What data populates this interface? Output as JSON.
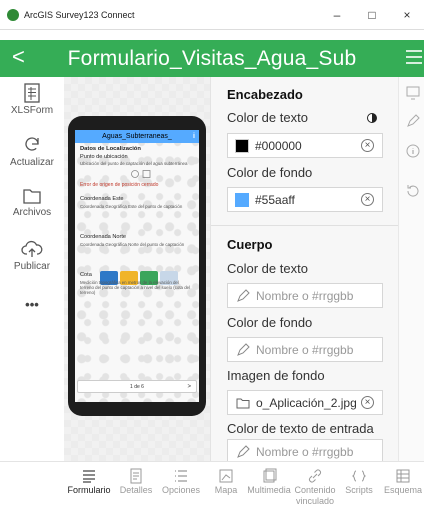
{
  "window": {
    "title": "ArcGIS Survey123 Connect",
    "minimize": "–",
    "maximize": "□",
    "close": "×"
  },
  "appbar": {
    "back_icon": "chevron-left-icon",
    "back": "<",
    "title": "Formulario_Visitas_Agua_Sub",
    "menu_icon": "hamburger-icon",
    "accent": "#35ad56"
  },
  "rail": {
    "items": [
      {
        "label": "XLSForm",
        "icon": "spreadsheet-icon"
      },
      {
        "label": "Actualizar",
        "icon": "refresh-icon"
      },
      {
        "label": "Archivos",
        "icon": "folder-icon"
      },
      {
        "label": "Publicar",
        "icon": "cloud-upload-icon"
      },
      {
        "label": "•••",
        "icon": "more-icon"
      }
    ]
  },
  "preview": {
    "header_title": "Aguas_Subterraneas_",
    "header_info": "i",
    "section": "Datos de Localización",
    "point_label": "Punto de ubicación",
    "point_hint": "Ubicación del punto de captación del agua subterránea",
    "position_error": "Error de origen de posición cerrado",
    "east_label": "Coordenada Este",
    "east_hint": "Coordenada Geográfica Este del punto de captación",
    "north_label": "Coordenada Norte",
    "north_hint": "Coordenada Geográfica Norte del punto de captación",
    "elevation_label": "Cota",
    "elevation_hint": "Medición topográfica en metros de la elevación del terreno del punto de captación a nivel del suelo (cota del terreno)",
    "page_indicator": "1 de 6",
    "next": ">",
    "header_color": "#55aaff"
  },
  "panel": {
    "header_section": "Encabezado",
    "header_text_color_label": "Color de texto",
    "header_text_color_value": "#000000",
    "header_bg_color_label": "Color de fondo",
    "header_bg_color_value": "#55aaff",
    "body_section": "Cuerpo",
    "body_text_color_label": "Color de texto",
    "body_bg_color_label": "Color de fondo",
    "body_bg_image_label": "Imagen de fondo",
    "body_bg_image_value": "o_Aplicación_2.jpg",
    "input_text_color_label": "Color de texto de entrada",
    "placeholder": "Nombre o #rrggbb",
    "clear": "×"
  },
  "strip": {
    "icons": [
      "monitor-icon",
      "brush-icon",
      "info-icon",
      "reset-icon"
    ]
  },
  "tabs": [
    {
      "label": "Formulario",
      "icon": "form-icon",
      "active": true
    },
    {
      "label": "Detalles",
      "icon": "details-icon",
      "active": false
    },
    {
      "label": "Opciones",
      "icon": "list-icon",
      "active": false
    },
    {
      "label": "Mapa",
      "icon": "map-icon",
      "active": false
    },
    {
      "label": "Multimedia",
      "icon": "media-icon",
      "active": false
    },
    {
      "label": "Contenido vinculado",
      "icon": "link-icon",
      "active": false
    },
    {
      "label": "Scripts",
      "icon": "code-icon",
      "active": false
    },
    {
      "label": "Esquema",
      "icon": "schema-icon",
      "active": false
    }
  ]
}
